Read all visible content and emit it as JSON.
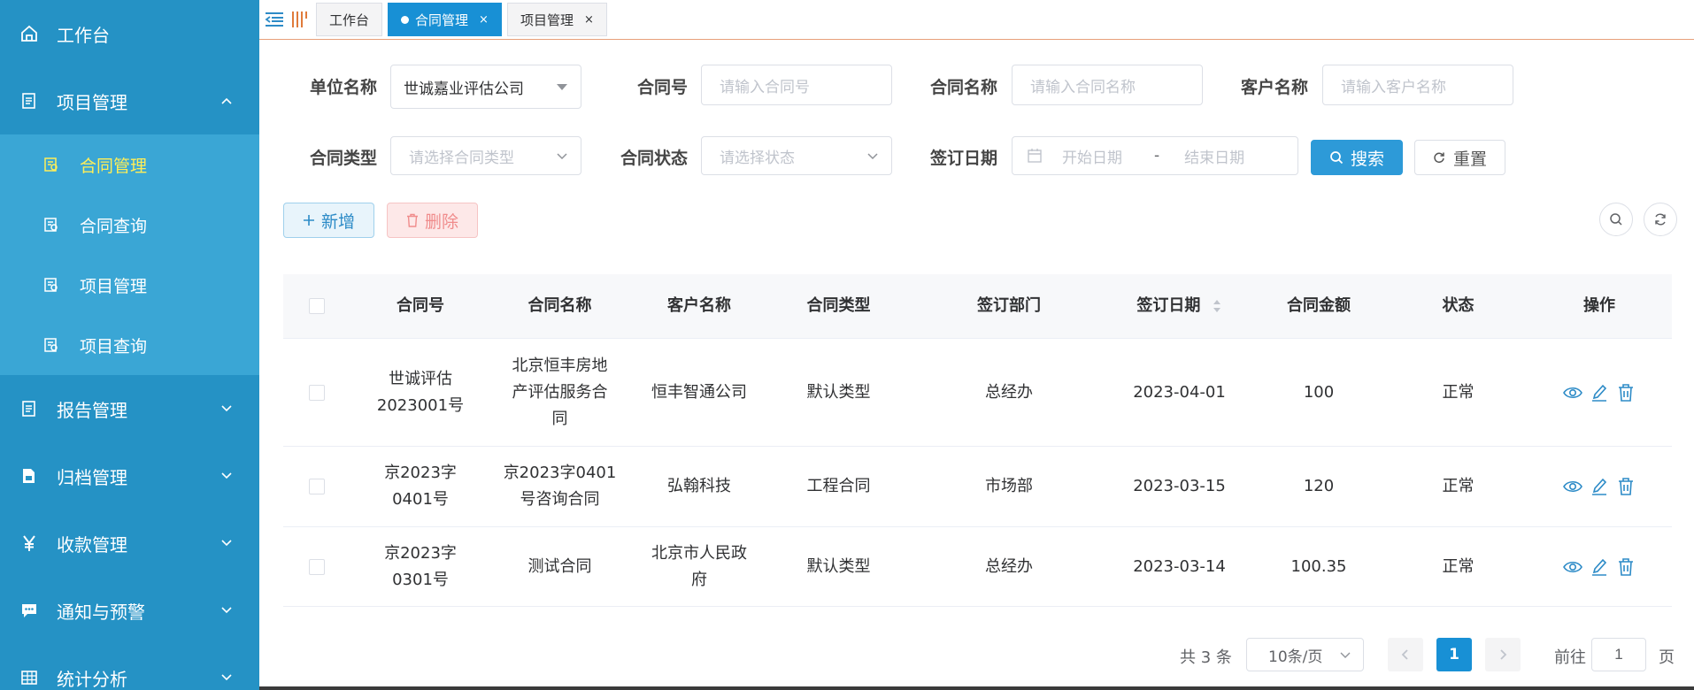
{
  "sidebar": {
    "items": [
      {
        "label": "工作台"
      },
      {
        "label": "项目管理"
      },
      {
        "label": "报告管理"
      },
      {
        "label": "归档管理"
      },
      {
        "label": "收款管理"
      },
      {
        "label": "通知与预警"
      },
      {
        "label": "统计分析"
      }
    ],
    "submenu": [
      {
        "label": "合同管理"
      },
      {
        "label": "合同查询"
      },
      {
        "label": "项目管理"
      },
      {
        "label": "项目查询"
      }
    ]
  },
  "tabs": [
    {
      "label": "工作台"
    },
    {
      "label": "合同管理"
    },
    {
      "label": "项目管理"
    }
  ],
  "tab_close": "×",
  "filters": {
    "unit_label": "单位名称",
    "unit_value": "世诚嘉业评估公司",
    "contract_no_label": "合同号",
    "contract_no_placeholder": "请输入合同号",
    "contract_name_label": "合同名称",
    "contract_name_placeholder": "请输入合同名称",
    "customer_label": "客户名称",
    "customer_placeholder": "请输入客户名称",
    "type_label": "合同类型",
    "type_placeholder": "请选择合同类型",
    "status_label": "合同状态",
    "status_placeholder": "请选择状态",
    "date_label": "签订日期",
    "start_placeholder": "开始日期",
    "date_sep": "-",
    "end_placeholder": "结束日期",
    "search_label": "搜索",
    "reset_label": "重置"
  },
  "toolbar": {
    "add_label": "新增",
    "delete_label": "删除"
  },
  "table": {
    "headers": [
      "合同号",
      "合同名称",
      "客户名称",
      "合同类型",
      "签订部门",
      "签订日期",
      "合同金额",
      "状态",
      "操作"
    ],
    "rows": [
      {
        "no": "世诚评估2023001号",
        "name": "北京恒丰房地产评估服务合同",
        "customer": "恒丰智通公司",
        "type": "默认类型",
        "dept": "总经办",
        "date": "2023-04-01",
        "amount": "100",
        "status": "正常"
      },
      {
        "no": "京2023字0401号",
        "name": "京2023字0401号咨询合同",
        "customer": "弘翰科技",
        "type": "工程合同",
        "dept": "市场部",
        "date": "2023-03-15",
        "amount": "120",
        "status": "正常"
      },
      {
        "no": "京2023字0301号",
        "name": "测试合同",
        "customer": "北京市人民政府",
        "type": "默认类型",
        "dept": "总经办",
        "date": "2023-03-14",
        "amount": "100.35",
        "status": "正常"
      }
    ]
  },
  "pagination": {
    "total_text": "共 3 条",
    "page_size": "10条/页",
    "current": "1",
    "goto_label": "前往",
    "goto_value": "1",
    "page_suffix": "页"
  },
  "colors": {
    "sidebar": "#2592c5",
    "submenu": "#3aa6d5",
    "active_text": "#ffee58",
    "primary": "#1890d5"
  }
}
